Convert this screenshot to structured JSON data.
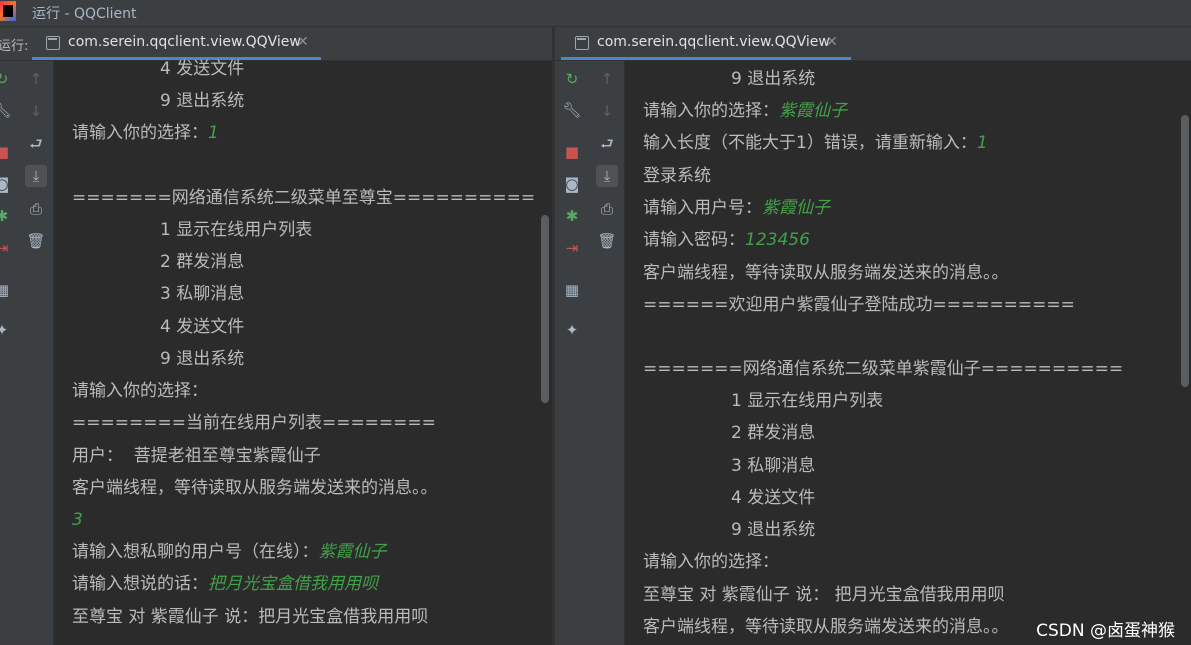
{
  "window": {
    "title": "运行 - QQClient"
  },
  "left": {
    "run_label": "运行:",
    "tab_label": "com.serein.qqclient.view.QQView",
    "lines": [
      "4 发送文件",
      "9 退出系统",
      "请输入你的选择：",
      "1",
      "",
      "=======网络通信系统二级菜单至尊宝==========",
      "1 显示在线用户列表",
      "2 群发消息",
      "3 私聊消息",
      "4 发送文件",
      "9 退出系统",
      "请输入你的选择：",
      "========当前在线用户列表========",
      "用户：  菩提老祖至尊宝紫霞仙子",
      "客户端线程，等待读取从服务端发送来的消息。。",
      "3",
      "请输入想私聊的用户号（在线）：",
      "紫霞仙子",
      "请输入想说的话：",
      "把月光宝盒借我用用呗",
      "至尊宝 对 紫霞仙子 说：把月光宝盒借我用用呗"
    ]
  },
  "right": {
    "tab_label": "com.serein.qqclient.view.QQView",
    "lines": [
      "9 退出系统",
      "请输入你的选择：",
      "紫霞仙子",
      "输入长度（不能大于1）错误，请重新输入：",
      "1",
      "登录系统",
      "请输入用户号：",
      "紫霞仙子",
      "请输入密码：",
      "123456",
      "客户端线程，等待读取从服务端发送来的消息。。",
      "======欢迎用户紫霞仙子登陆成功==========",
      "",
      "=======网络通信系统二级菜单紫霞仙子==========",
      "1 显示在线用户列表",
      "2 群发消息",
      "3 私聊消息",
      "4 发送文件",
      "9 退出系统",
      "请输入你的选择：",
      "至尊宝 对 紫霞仙子 说： 把月光宝盒借我用用呗",
      "客户端线程，等待读取从服务端发送来的消息。。"
    ]
  },
  "watermark": "CSDN @卤蛋神猴",
  "colors": {
    "background": "#2b2b2b",
    "toolbar": "#3c3f41",
    "output_text": "#bbbbbb",
    "user_input": "#41a149",
    "tab_underline": "#4a88c7"
  },
  "icons": [
    "rerun-icon",
    "wrench-icon",
    "stop-icon",
    "camera-icon",
    "bug-icon",
    "exit-icon",
    "layout-icon",
    "pin-icon",
    "arrow-up-icon",
    "arrow-down-icon",
    "soft-wrap-icon",
    "scroll-to-end-icon",
    "print-icon",
    "trash-icon",
    "close-icon"
  ]
}
